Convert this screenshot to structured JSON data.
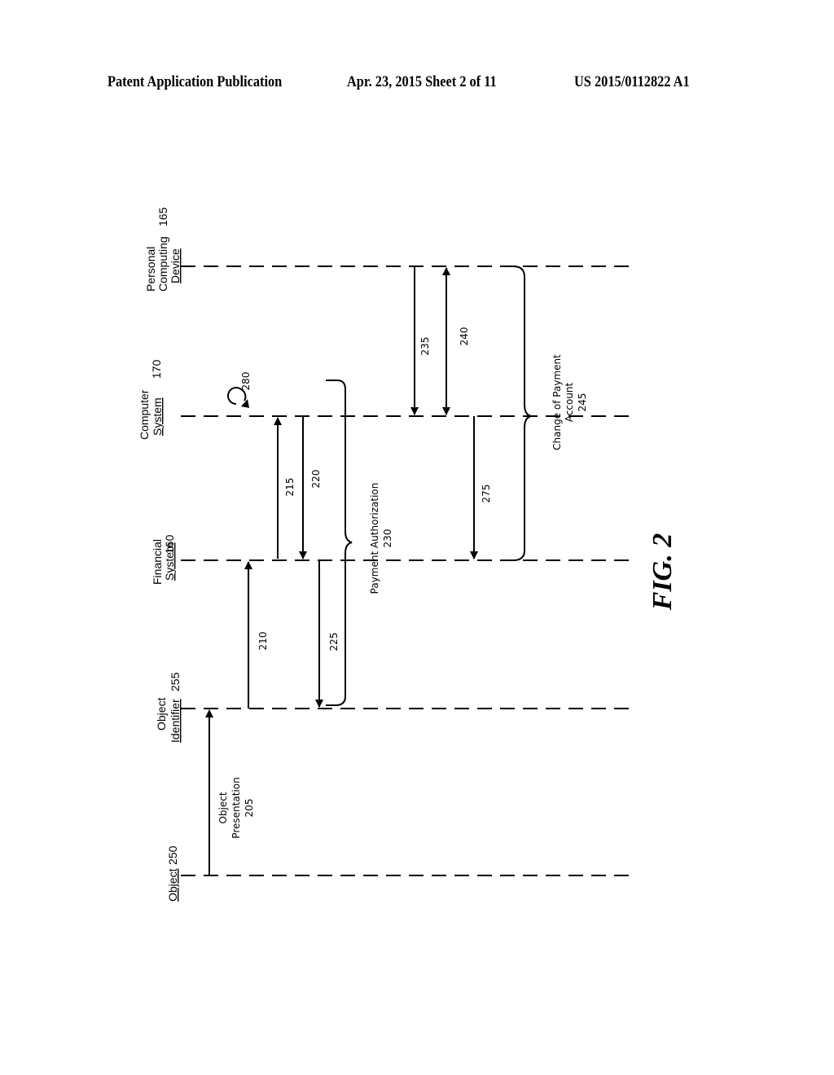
{
  "header": {
    "publication": "Patent Application Publication",
    "date_sheet": "Apr. 23, 2015  Sheet 2 of 11",
    "number": "US 2015/0112822 A1"
  },
  "figure": {
    "label": "FIG. 2",
    "lifelines": [
      {
        "id": "165",
        "line1": "Personal",
        "line2": "Computing",
        "line3": "Device",
        "ref": "165"
      },
      {
        "id": "170",
        "line1": "Computer",
        "line2": "System",
        "ref": "170"
      },
      {
        "id": "160",
        "line1": "Financial",
        "line2": "System",
        "ref": "160"
      },
      {
        "id": "255",
        "line1": "Object",
        "line2": "Identifier",
        "ref": "255"
      },
      {
        "id": "250",
        "line1": "Object",
        "ref": "250"
      }
    ],
    "messages": [
      {
        "ref": "205",
        "line1": "Object",
        "line2": "Presentation",
        "line3": "205"
      },
      {
        "ref": "210",
        "label": "210"
      },
      {
        "ref": "215",
        "label": "215"
      },
      {
        "ref": "220",
        "label": "220"
      },
      {
        "ref": "225",
        "label": "225"
      },
      {
        "ref": "235",
        "label": "235"
      },
      {
        "ref": "240",
        "label": "240"
      },
      {
        "ref": "275",
        "label": "275"
      },
      {
        "ref": "280",
        "label": "280"
      }
    ],
    "groups": [
      {
        "ref": "230",
        "line1": "Payment Authorization",
        "line2": "230"
      },
      {
        "ref": "245",
        "line1": "Change of Payment",
        "line2": "Account",
        "line3": "245"
      }
    ]
  }
}
